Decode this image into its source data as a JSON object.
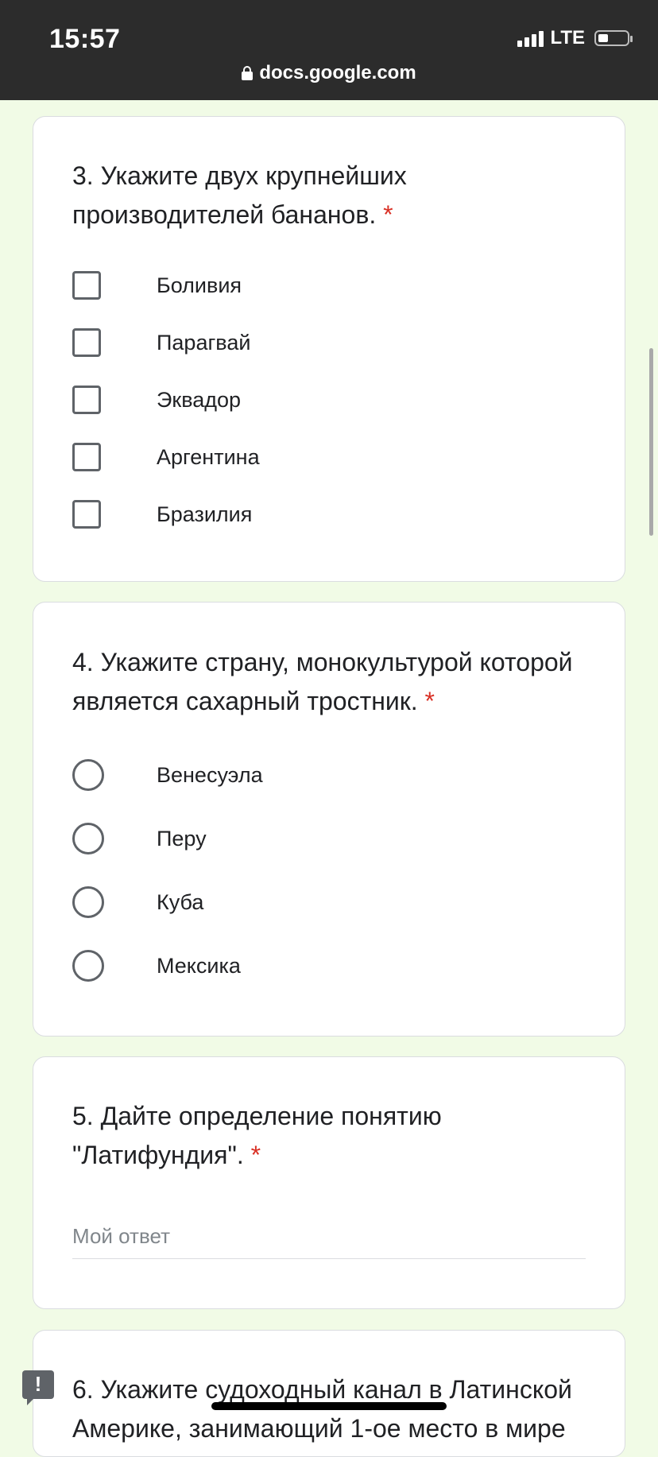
{
  "statusbar": {
    "time": "15:57",
    "network": "LTE",
    "battery_level": 0.35
  },
  "browser": {
    "url": "docs.google.com"
  },
  "questions": [
    {
      "title": "3. Укажите двух крупнейших производителей бананов.",
      "required_mark": "*",
      "type": "checkbox",
      "options": [
        "Боливия",
        "Парагвай",
        "Эквадор",
        "Аргентина",
        "Бразилия"
      ]
    },
    {
      "title": "4. Укажите страну, монокультурой которой является сахарный тростник.",
      "required_mark": "*",
      "type": "radio",
      "options": [
        "Венесуэла",
        "Перу",
        "Куба",
        "Мексика"
      ]
    },
    {
      "title": "5. Дайте определение понятию \"Латифундия\".",
      "required_mark": "*",
      "type": "text",
      "placeholder": "Мой ответ"
    },
    {
      "title": "6. Укажите судоходный канал в Латинской Америке, занимающий 1-ое место в мире",
      "type": "text"
    }
  ],
  "icons": {
    "report": "report-problem-icon",
    "secure": "lock-icon"
  },
  "colors": {
    "background": "#f1fbe6",
    "required": "#d93025",
    "statusbar": "#2c2c2c"
  }
}
